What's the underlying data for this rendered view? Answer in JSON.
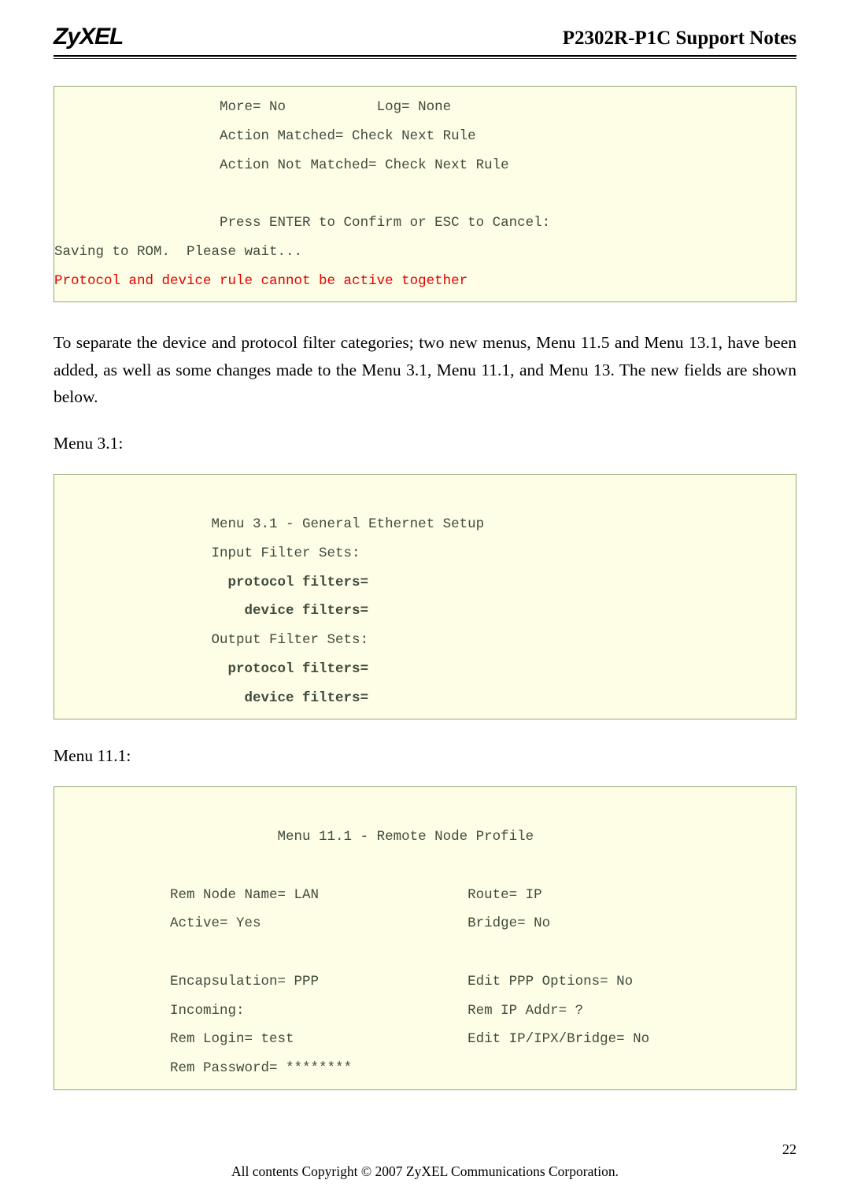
{
  "header": {
    "logo": "ZyXEL",
    "title": "P2302R-P1C Support Notes"
  },
  "box1": {
    "l1": "                    More= No           Log= None",
    "l2": "                    Action Matched= Check Next Rule",
    "l3": "                    Action Not Matched= Check Next Rule",
    "l4": "",
    "l5": "                    Press ENTER to Confirm or ESC to Cancel:",
    "l6": "Saving to ROM.  Please wait...",
    "l7": "Protocol and device rule cannot be active together"
  },
  "para1": "To separate the device and protocol filter categories; two new menus, Menu 11.5 and Menu 13.1, have been added, as well as some changes made to the Menu 3.1, Menu 11.1, and Menu 13. The new fields are shown below.",
  "label1": "Menu 3.1:",
  "box2": {
    "l1": "",
    "l2": "                   Menu 3.1 - General Ethernet Setup",
    "l3": "                   Input Filter Sets:",
    "l4": "                     protocol filters=",
    "l5": "                       device filters=",
    "l6": "                   Output Filter Sets:",
    "l7": "                     protocol filters=",
    "l8": "                       device filters=",
    "l9": ""
  },
  "label2": "Menu 11.1:",
  "box3": {
    "l1": "",
    "l2": "                           Menu 11.1 - Remote Node Profile",
    "l3": "",
    "l4a": "              Rem Node Name= LAN",
    "l4b": "                  Route= IP",
    "l5a": "              Active= Yes",
    "l5b": "                         Bridge= No",
    "l6": "",
    "l7a": "              Encapsulation= PPP",
    "l7b": "                  Edit PPP Options= No",
    "l8a": "              Incoming:",
    "l8b": "                           Rem IP Addr= ?",
    "l9a": "              Rem Login= test",
    "l9b": "                     Edit IP/IPX/Bridge= No",
    "l10": "              Rem Password= ********"
  },
  "footer": {
    "copyright": "All contents Copyright © 2007 ZyXEL Communications Corporation.",
    "page": "22"
  }
}
